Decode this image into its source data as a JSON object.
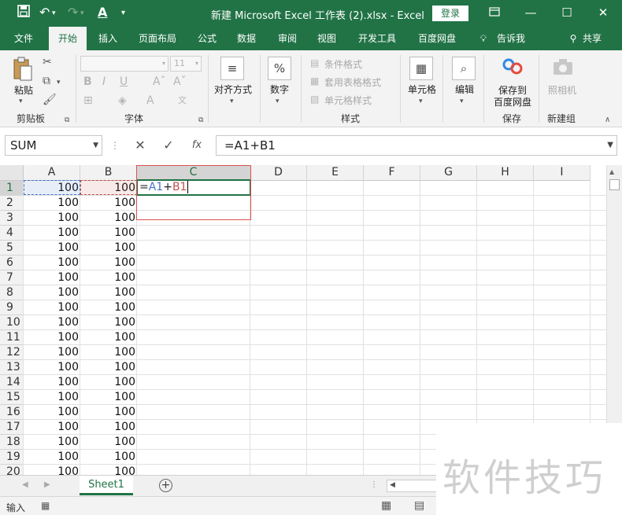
{
  "title_bar": {
    "title": "新建 Microsoft Excel 工作表 (2).xlsx  -  Excel",
    "login": "登录",
    "save_icon": "save-icon",
    "undo_icon": "undo-icon",
    "redo_icon": "redo-icon",
    "font_color_icon": "font-color-icon"
  },
  "ribbon_tabs": [
    "文件",
    "开始",
    "插入",
    "页面布局",
    "公式",
    "数据",
    "审阅",
    "视图",
    "开发工具",
    "百度网盘",
    "告诉我",
    "共享"
  ],
  "active_tab": "开始",
  "ribbon": {
    "clipboard": {
      "label": "剪贴板",
      "paste": "粘贴"
    },
    "font": {
      "label": "字体",
      "font_size": "11"
    },
    "alignment": {
      "button": "对齐方式"
    },
    "number": {
      "button": "数字",
      "icon_glyph": "%"
    },
    "styles": {
      "label": "样式",
      "conditional_format": "条件格式",
      "format_as_table": "套用表格格式",
      "cell_styles": "单元格样式"
    },
    "cells": {
      "button": "单元格"
    },
    "editing": {
      "button": "编辑"
    },
    "save": {
      "label": "保存",
      "button_line1": "保存到",
      "button_line2": "百度网盘"
    },
    "new_group": {
      "label": "新建组",
      "camera": "照相机"
    }
  },
  "formula_bar": {
    "name_box": "SUM",
    "fx": "fx",
    "formula": "=A1+B1"
  },
  "columns": [
    "A",
    "B",
    "C",
    "D",
    "E",
    "F",
    "G",
    "H",
    "I"
  ],
  "rows": [
    {
      "n": "1",
      "a": "100",
      "b": "100"
    },
    {
      "n": "2",
      "a": "100",
      "b": "100"
    },
    {
      "n": "3",
      "a": "100",
      "b": "100"
    },
    {
      "n": "4",
      "a": "100",
      "b": "100"
    },
    {
      "n": "5",
      "a": "100",
      "b": "100"
    },
    {
      "n": "6",
      "a": "100",
      "b": "100"
    },
    {
      "n": "7",
      "a": "100",
      "b": "100"
    },
    {
      "n": "8",
      "a": "100",
      "b": "100"
    },
    {
      "n": "9",
      "a": "100",
      "b": "100"
    },
    {
      "n": "10",
      "a": "100",
      "b": "100"
    },
    {
      "n": "11",
      "a": "100",
      "b": "100"
    },
    {
      "n": "12",
      "a": "100",
      "b": "100"
    },
    {
      "n": "13",
      "a": "100",
      "b": "100"
    },
    {
      "n": "14",
      "a": "100",
      "b": "100"
    },
    {
      "n": "15",
      "a": "100",
      "b": "100"
    },
    {
      "n": "16",
      "a": "100",
      "b": "100"
    },
    {
      "n": "17",
      "a": "100",
      "b": "100"
    },
    {
      "n": "18",
      "a": "100",
      "b": "100"
    },
    {
      "n": "19",
      "a": "100",
      "b": "100"
    },
    {
      "n": "20",
      "a": "100",
      "b": "100"
    }
  ],
  "active_cell": {
    "ref": "C1",
    "edit_parts": [
      "=",
      "A1",
      "+",
      "B1"
    ]
  },
  "sheet_tabs": [
    "Sheet1"
  ],
  "status_bar": {
    "mode": "输入"
  },
  "watermark": "软件技巧",
  "colors": {
    "excel_green": "#217346",
    "ref_a": "#4472c4",
    "ref_b": "#c0504d",
    "highlight_red": "#d9534f"
  }
}
